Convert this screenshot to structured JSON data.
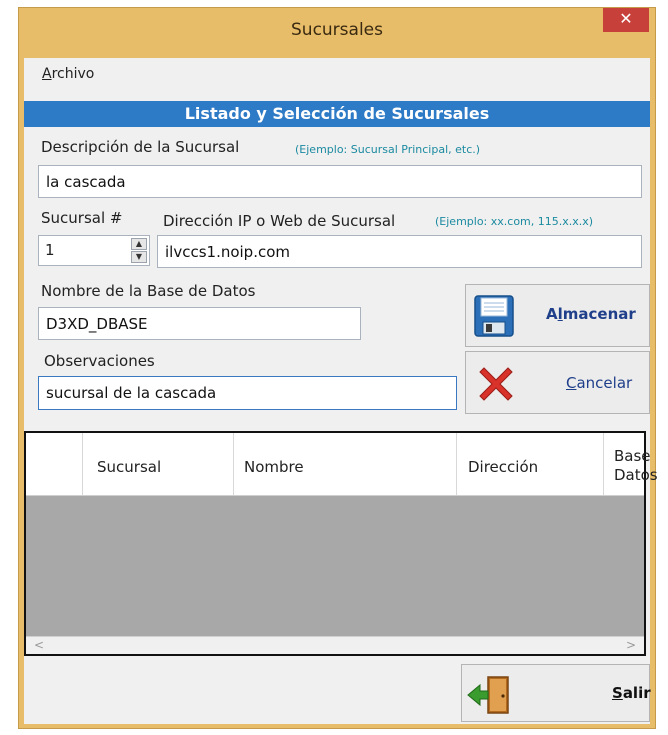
{
  "window": {
    "title": "Sucursales",
    "close_glyph": "✕"
  },
  "menu": {
    "archivo_first": "A",
    "archivo_rest": "rchivo"
  },
  "header": {
    "title": "Listado y Selección de Sucursales"
  },
  "form": {
    "descripcion_label": "Descripción de la Sucursal",
    "descripcion_hint": "(Ejemplo: Sucursal Principal, etc.)",
    "descripcion_value": "la cascada",
    "sucursal_label": "Sucursal #",
    "sucursal_value": "1",
    "direccion_label": "Dirección IP o Web de Sucursal",
    "direccion_hint": "(Ejemplo: xx.com, 115.x.x.x)",
    "direccion_value": "ilvccs1.noip.com",
    "basedatos_label": "Nombre de la Base de Datos",
    "basedatos_value": "D3XD_DBASE",
    "observaciones_label": "Observaciones",
    "observaciones_value": "sucursal de la cascada"
  },
  "buttons": {
    "almacenar_pre": "A",
    "almacenar_ul": "l",
    "almacenar_post": "macenar",
    "cancelar_ul": "C",
    "cancelar_post": "ancelar",
    "salir_ul": "S",
    "salir_post": "alir"
  },
  "grid": {
    "columns": [
      "Sucursal",
      "Nombre",
      "Dirección",
      "Base",
      "Datos"
    ]
  },
  "icons": {
    "save": "floppy-disk-icon",
    "cancel": "red-x-icon",
    "exit": "exit-door-icon",
    "spin_up": "▲",
    "spin_down": "▼",
    "scroll_left": "<",
    "scroll_right": ">"
  },
  "colors": {
    "titlebar": "#e8bd6a",
    "header_band": "#2d7ac6",
    "close": "#c7413a",
    "hint": "#1b8aa0",
    "primary_button_text": "#1f3f8a"
  }
}
